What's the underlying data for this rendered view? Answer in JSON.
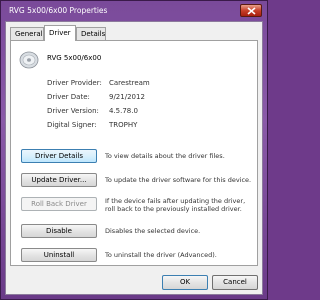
{
  "window": {
    "title": "RVG 5x00/6x00 Properties"
  },
  "tabs": [
    {
      "label": "General"
    },
    {
      "label": "Driver"
    },
    {
      "label": "Details"
    }
  ],
  "device": {
    "name": "RVG 5x00/6x00",
    "icon": "disc-drive-icon"
  },
  "properties": [
    {
      "label": "Driver Provider:",
      "value": "Carestream"
    },
    {
      "label": "Driver Date:",
      "value": "9/21/2012"
    },
    {
      "label": "Driver Version:",
      "value": "4.5.78.0"
    },
    {
      "label": "Digital Signer:",
      "value": "TROPHY"
    }
  ],
  "actions": [
    {
      "label": "Driver Details",
      "description": "To view details about the driver files.",
      "enabled": true
    },
    {
      "label": "Update Driver...",
      "description": "To update the driver software for this device.",
      "enabled": true
    },
    {
      "label": "Roll Back Driver",
      "description": "If the device fails after updating the driver, roll back to the previously installed driver.",
      "enabled": false
    },
    {
      "label": "Disable",
      "description": "Disables the selected device.",
      "enabled": true
    },
    {
      "label": "Uninstall",
      "description": "To uninstall the driver (Advanced).",
      "enabled": true
    }
  ],
  "footer": {
    "ok_label": "OK",
    "cancel_label": "Cancel"
  },
  "colors": {
    "title_bar": "#7a4a9a",
    "close_button": "#c8402a",
    "focus_border": "#3c7fb1"
  }
}
